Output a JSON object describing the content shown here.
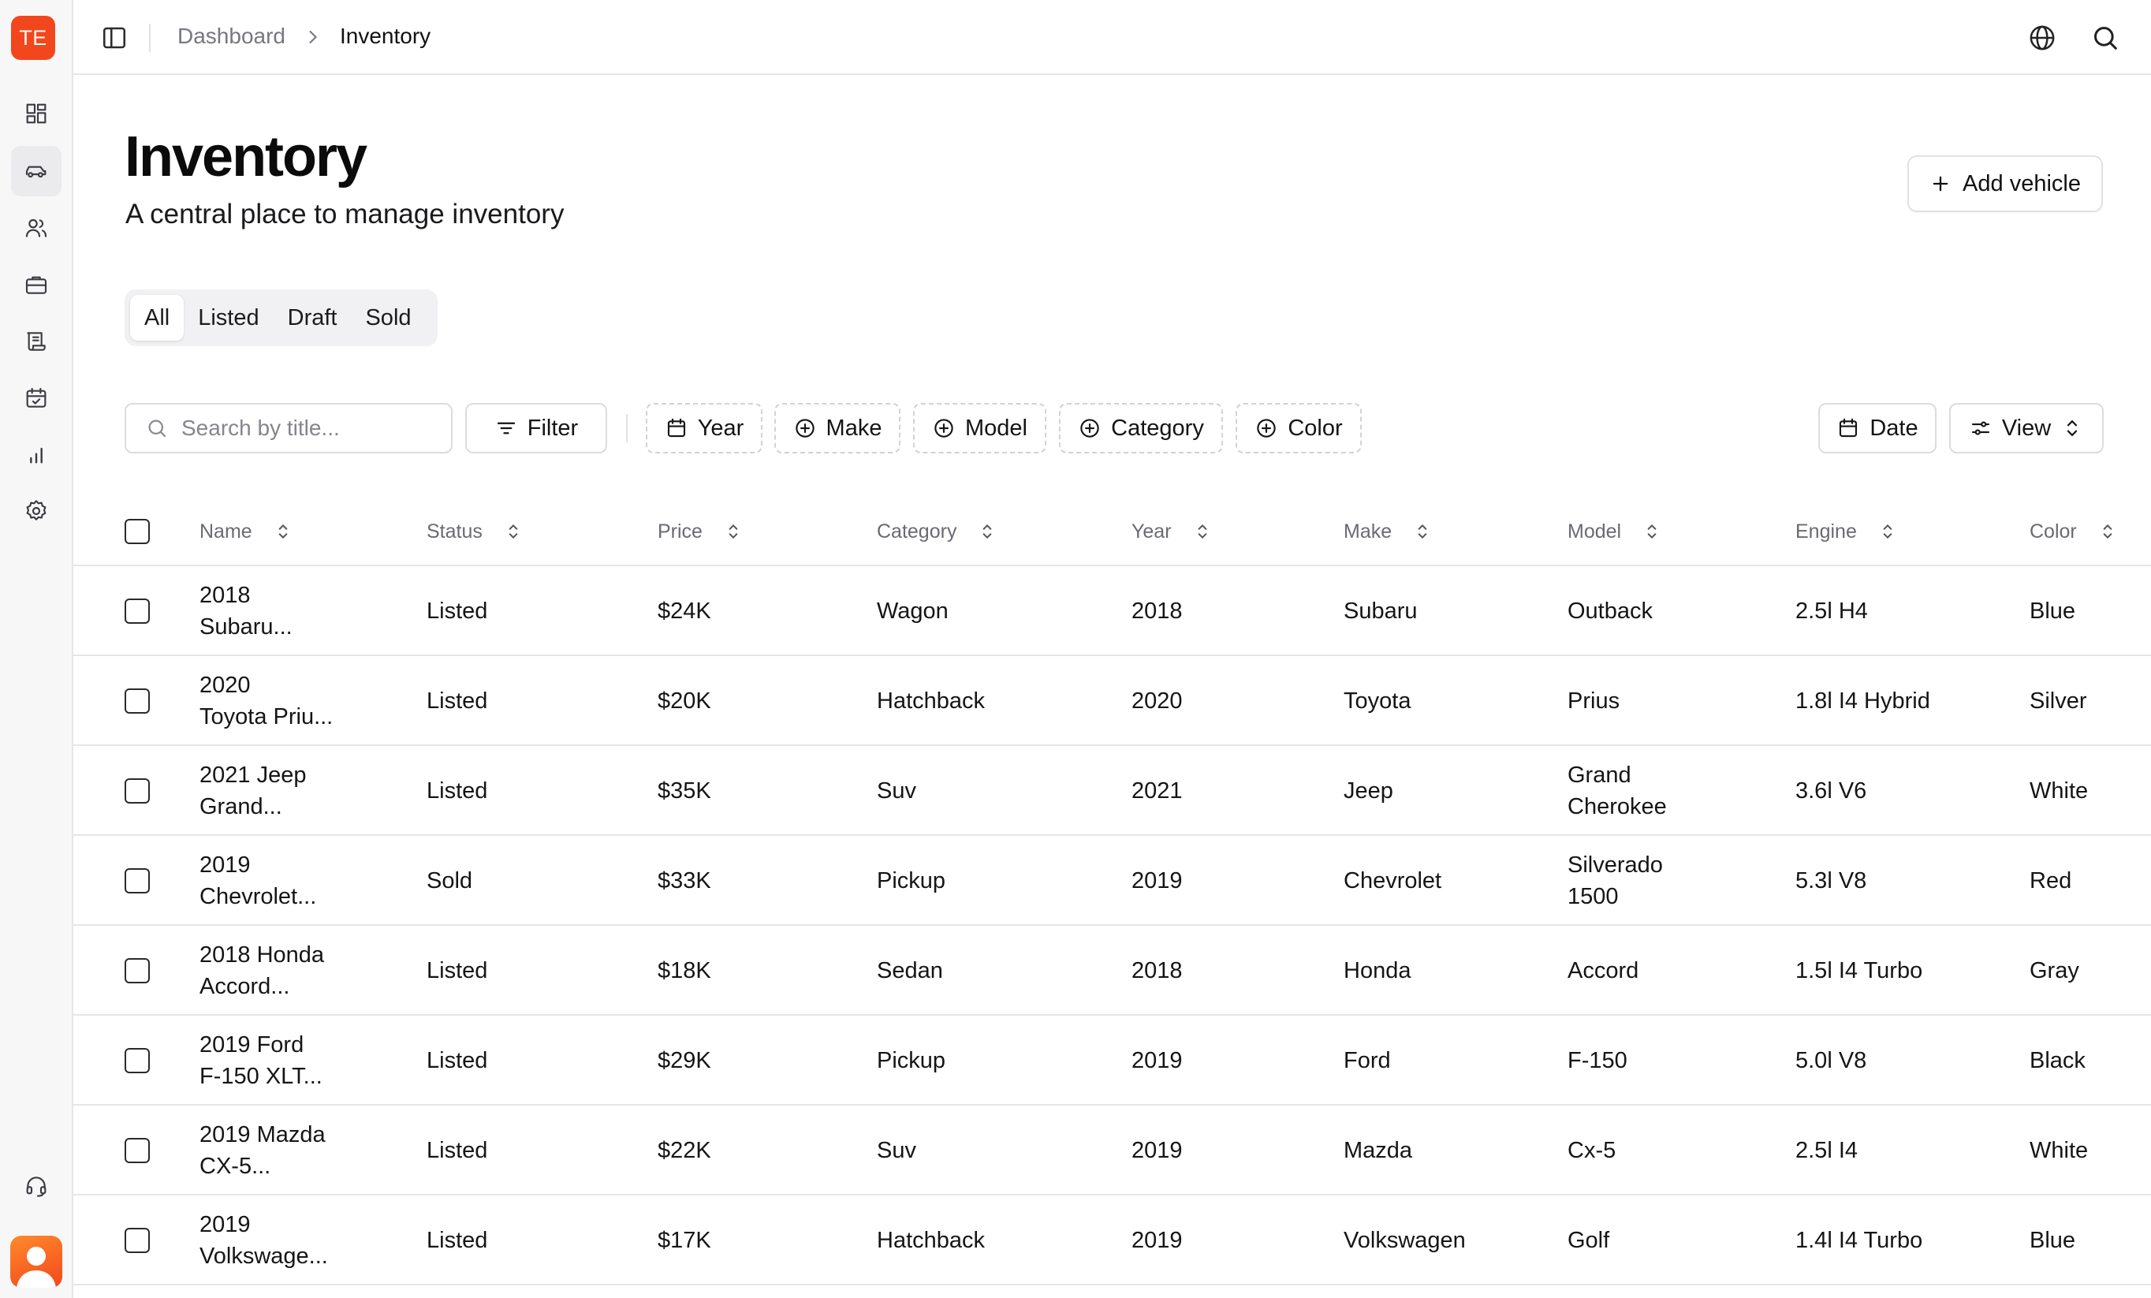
{
  "app": {
    "logo_text": "TE"
  },
  "sidebar": {
    "items": [
      {
        "icon": "dashboard-grid-icon"
      },
      {
        "icon": "car-icon",
        "active": true
      },
      {
        "icon": "users-icon"
      },
      {
        "icon": "briefcase-icon"
      },
      {
        "icon": "scroll-icon"
      },
      {
        "icon": "calendar-check-icon"
      },
      {
        "icon": "bar-chart-icon"
      },
      {
        "icon": "gear-icon"
      }
    ],
    "bottom": [
      {
        "icon": "headset-icon"
      },
      {
        "icon": "avatar"
      }
    ]
  },
  "header": {
    "breadcrumb": [
      "Dashboard",
      "Inventory"
    ],
    "right_icons": [
      "globe-icon",
      "search-icon"
    ]
  },
  "page": {
    "title": "Inventory",
    "subtitle": "A central place to manage inventory",
    "add_button": "Add vehicle"
  },
  "tabs": [
    {
      "label": "All",
      "active": true
    },
    {
      "label": "Listed"
    },
    {
      "label": "Draft"
    },
    {
      "label": "Sold"
    }
  ],
  "toolbar": {
    "search_placeholder": "Search by title...",
    "filter": "Filter",
    "facets": [
      "Year",
      "Make",
      "Model",
      "Category",
      "Color"
    ],
    "date": "Date",
    "view": "View"
  },
  "table": {
    "columns": [
      "Name",
      "Status",
      "Price",
      "Category",
      "Year",
      "Make",
      "Model",
      "Engine",
      "Color"
    ],
    "rows": [
      {
        "name": [
          "2018",
          "Subaru..."
        ],
        "status": "Listed",
        "price": "$24K",
        "category": "Wagon",
        "year": "2018",
        "make": "Subaru",
        "model": [
          "Outback"
        ],
        "engine": "2.5l H4",
        "color": "Blue"
      },
      {
        "name": [
          "2020",
          "Toyota Priu..."
        ],
        "status": "Listed",
        "price": "$20K",
        "category": "Hatchback",
        "year": "2020",
        "make": "Toyota",
        "model": [
          "Prius"
        ],
        "engine": "1.8l I4 Hybrid",
        "color": "Silver"
      },
      {
        "name": [
          "2021 Jeep",
          "Grand..."
        ],
        "status": "Listed",
        "price": "$35K",
        "category": "Suv",
        "year": "2021",
        "make": "Jeep",
        "model": [
          "Grand",
          "Cherokee"
        ],
        "engine": "3.6l V6",
        "color": "White"
      },
      {
        "name": [
          "2019",
          "Chevrolet..."
        ],
        "status": "Sold",
        "price": "$33K",
        "category": "Pickup",
        "year": "2019",
        "make": "Chevrolet",
        "model": [
          "Silverado",
          "1500"
        ],
        "engine": "5.3l V8",
        "color": "Red"
      },
      {
        "name": [
          "2018 Honda",
          "Accord..."
        ],
        "status": "Listed",
        "price": "$18K",
        "category": "Sedan",
        "year": "2018",
        "make": "Honda",
        "model": [
          "Accord"
        ],
        "engine": "1.5l I4 Turbo",
        "color": "Gray"
      },
      {
        "name": [
          "2019 Ford",
          "F-150 XLT..."
        ],
        "status": "Listed",
        "price": "$29K",
        "category": "Pickup",
        "year": "2019",
        "make": "Ford",
        "model": [
          "F-150"
        ],
        "engine": "5.0l V8",
        "color": "Black"
      },
      {
        "name": [
          "2019 Mazda",
          "CX-5..."
        ],
        "status": "Listed",
        "price": "$22K",
        "category": "Suv",
        "year": "2019",
        "make": "Mazda",
        "model": [
          "Cx-5"
        ],
        "engine": "2.5l I4",
        "color": "White"
      },
      {
        "name": [
          "2019",
          "Volkswage..."
        ],
        "status": "Listed",
        "price": "$17K",
        "category": "Hatchback",
        "year": "2019",
        "make": "Volkswagen",
        "model": [
          "Golf"
        ],
        "engine": "1.4l I4 Turbo",
        "color": "Blue"
      }
    ]
  },
  "colors": {
    "accent": "#f2471c",
    "border": "#e6e6e8",
    "muted_text": "#777780"
  }
}
